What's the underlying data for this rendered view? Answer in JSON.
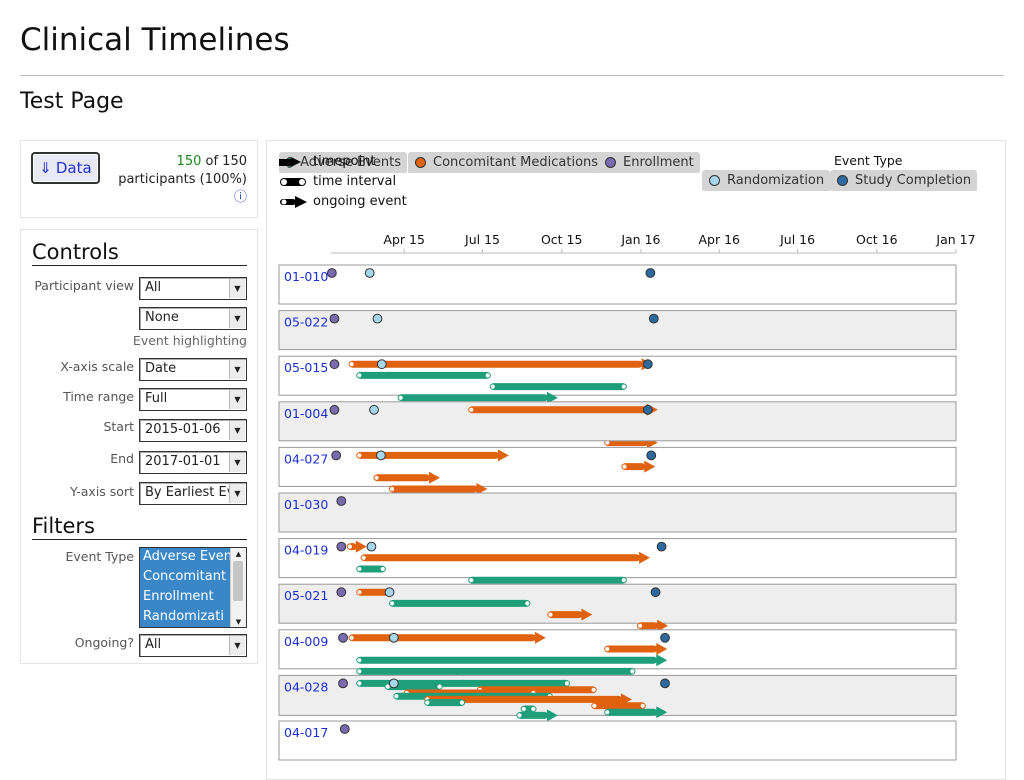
{
  "page": {
    "title": "Clinical Timelines",
    "subtitle": "Test Page"
  },
  "data_panel": {
    "button_label": "Data",
    "button_icon": "arrow-down-icon",
    "count": "150",
    "count_suffix": "of 150",
    "count_line2": "participants (100%)",
    "info_icon": "info-icon"
  },
  "controls": {
    "heading": "Controls",
    "participant_view_label": "Participant view",
    "participant_view_value": "All",
    "highlight_value": "None",
    "highlight_label": "Event highlighting",
    "xaxis_label": "X-axis scale",
    "xaxis_value": "Date",
    "range_label": "Time range",
    "range_value": "Full",
    "start_label": "Start",
    "start_value": "2015-01-06",
    "end_label": "End",
    "end_value": "2017-01-01",
    "sort_label": "Y-axis sort",
    "sort_value": "By Earliest Ev"
  },
  "filters": {
    "heading": "Filters",
    "event_type_label": "Event Type",
    "event_type_options": [
      "Adverse Even",
      "Concomitant",
      "Enrollment",
      "Randomizati"
    ],
    "ongoing_label": "Ongoing?",
    "ongoing_value": "All"
  },
  "legend": {
    "shape_items": [
      "timepoint",
      "time interval",
      "ongoing event"
    ],
    "shape_items_overlap": "Adverse Events",
    "title": "Event Type",
    "event_types": [
      {
        "label": "Concomitant Medications",
        "color": "#e0620f"
      },
      {
        "label": "Enrollment",
        "color": "#7a6ab0"
      },
      {
        "label": "Randomization",
        "color": "#a6d6ea"
      },
      {
        "label": "Study Completion",
        "color": "#2c6aa0"
      }
    ]
  },
  "colors": {
    "adverse_events": "#1f9e7a",
    "concomitant_medications": "#e0620f",
    "enrollment": "#7a6ab0",
    "randomization": "#a6d6ea",
    "study_completion": "#2c6aa0",
    "participant_link": "#1b2fd6"
  },
  "chart_data": {
    "type": "timeline",
    "x_axis": {
      "scale": "date",
      "domain": [
        "2015-01-06",
        "2017-01-01"
      ],
      "ticks": [
        "Apr 15",
        "Jul 15",
        "Oct 15",
        "Jan 16",
        "Apr 16",
        "Jul 16",
        "Oct 16",
        "Jan 17"
      ]
    },
    "participants": [
      {
        "id": "01-010",
        "points": [
          {
            "type": "enrollment",
            "date": "2015-01-07"
          },
          {
            "type": "randomization",
            "date": "2015-02-20"
          },
          {
            "type": "completion",
            "date": "2016-01-12"
          }
        ],
        "intervals": []
      },
      {
        "id": "05-022",
        "points": [
          {
            "type": "enrollment",
            "date": "2015-01-10"
          },
          {
            "type": "randomization",
            "date": "2015-03-01"
          },
          {
            "type": "completion",
            "date": "2016-01-16"
          }
        ],
        "intervals": []
      },
      {
        "id": "05-015",
        "points": [
          {
            "type": "enrollment",
            "date": "2015-01-10"
          },
          {
            "type": "randomization",
            "date": "2015-03-06"
          },
          {
            "type": "completion",
            "date": "2016-01-09"
          }
        ],
        "intervals": [
          {
            "type": "cm",
            "start": "2015-01-27",
            "end": "2016-01-03",
            "ongoing": true
          },
          {
            "type": "ae",
            "start": "2015-02-05",
            "end": "2015-07-10"
          },
          {
            "type": "ae",
            "start": "2015-07-10",
            "end": "2015-12-15"
          },
          {
            "type": "ae",
            "start": "2015-03-25",
            "end": "2015-09-15",
            "ongoing": true
          },
          {
            "type": "cm",
            "start": "2015-11-10",
            "end": "2015-12-25"
          },
          {
            "type": "cm",
            "start": "2015-04-15",
            "end": "2015-05-25",
            "ongoing": true
          },
          {
            "type": "ae",
            "start": "2015-08-30",
            "end": "2015-09-25"
          },
          {
            "type": "cm",
            "start": "2015-11-20",
            "end": "2016-01-09",
            "ongoing": true
          }
        ]
      },
      {
        "id": "01-004",
        "points": [
          {
            "type": "enrollment",
            "date": "2015-01-10"
          },
          {
            "type": "randomization",
            "date": "2015-02-25"
          },
          {
            "type": "completion",
            "date": "2016-01-09"
          }
        ],
        "intervals": [
          {
            "type": "cm",
            "start": "2015-06-15",
            "end": "2016-01-09",
            "ongoing": true
          }
        ]
      },
      {
        "id": "04-027",
        "points": [
          {
            "type": "enrollment",
            "date": "2015-01-12"
          },
          {
            "type": "randomization",
            "date": "2015-03-05"
          },
          {
            "type": "completion",
            "date": "2016-01-13"
          }
        ],
        "intervals": [
          {
            "type": "cm",
            "start": "2015-02-05",
            "end": "2015-07-20",
            "ongoing": true
          },
          {
            "type": "cm",
            "start": "2015-12-10",
            "end": "2016-01-06",
            "ongoing": true
          },
          {
            "type": "cm",
            "start": "2015-02-25",
            "end": "2015-05-01",
            "ongoing": true
          },
          {
            "type": "cm",
            "start": "2015-03-15",
            "end": "2015-06-25",
            "ongoing": true
          }
        ]
      },
      {
        "id": "01-030",
        "points": [
          {
            "type": "enrollment",
            "date": "2015-01-18"
          }
        ],
        "intervals": []
      },
      {
        "id": "04-019",
        "points": [
          {
            "type": "enrollment",
            "date": "2015-01-18"
          },
          {
            "type": "randomization",
            "date": "2015-02-22"
          },
          {
            "type": "completion",
            "date": "2016-01-25"
          }
        ],
        "intervals": [
          {
            "type": "cm",
            "start": "2015-01-25",
            "end": "2015-02-05",
            "ongoing": true
          },
          {
            "type": "cm",
            "start": "2015-02-10",
            "end": "2015-12-31",
            "ongoing": true
          },
          {
            "type": "ae",
            "start": "2015-02-05",
            "end": "2015-03-10"
          },
          {
            "type": "ae",
            "start": "2015-06-15",
            "end": "2015-12-15"
          },
          {
            "type": "ae",
            "start": "2015-03-05",
            "end": "2015-05-15"
          },
          {
            "type": "ae",
            "start": "2015-03-10",
            "end": "2015-12-01"
          }
        ]
      },
      {
        "id": "05-021",
        "points": [
          {
            "type": "enrollment",
            "date": "2015-01-18"
          },
          {
            "type": "randomization",
            "date": "2015-03-15"
          },
          {
            "type": "completion",
            "date": "2016-01-18"
          }
        ],
        "intervals": [
          {
            "type": "cm",
            "start": "2015-02-05",
            "end": "2015-03-15"
          },
          {
            "type": "ae",
            "start": "2015-03-15",
            "end": "2015-08-25"
          },
          {
            "type": "cm",
            "start": "2015-09-15",
            "end": "2015-10-25",
            "ongoing": true
          },
          {
            "type": "cm",
            "start": "2015-12-28",
            "end": "2016-01-21",
            "ongoing": true
          },
          {
            "type": "ae",
            "start": "2015-03-30",
            "end": "2015-12-15"
          },
          {
            "type": "ae",
            "start": "2015-04-25",
            "end": "2016-01-15",
            "ongoing": true
          },
          {
            "type": "cm",
            "start": "2015-07-15",
            "end": "2015-09-10"
          },
          {
            "type": "ae",
            "start": "2015-04-20",
            "end": "2015-06-01",
            "ongoing": true
          }
        ]
      },
      {
        "id": "04-009",
        "points": [
          {
            "type": "enrollment",
            "date": "2015-01-20"
          },
          {
            "type": "randomization",
            "date": "2015-03-20"
          },
          {
            "type": "completion",
            "date": "2016-01-29"
          }
        ],
        "intervals": [
          {
            "type": "cm",
            "start": "2015-01-27",
            "end": "2015-09-01",
            "ongoing": true
          },
          {
            "type": "cm",
            "start": "2015-11-20",
            "end": "2016-01-20",
            "ongoing": true
          },
          {
            "type": "ae",
            "start": "2015-02-05",
            "end": "2016-01-20",
            "ongoing": true
          },
          {
            "type": "ae",
            "start": "2015-02-05",
            "end": "2015-12-25"
          }
        ]
      },
      {
        "id": "04-028",
        "points": [
          {
            "type": "enrollment",
            "date": "2015-01-20"
          },
          {
            "type": "randomization",
            "date": "2015-03-20"
          },
          {
            "type": "completion",
            "date": "2016-01-29"
          }
        ],
        "intervals": [
          {
            "type": "ae",
            "start": "2015-02-05",
            "end": "2015-10-10"
          },
          {
            "type": "ae",
            "start": "2015-03-10",
            "end": "2015-05-15"
          },
          {
            "type": "cm",
            "start": "2015-06-25",
            "end": "2015-11-10"
          },
          {
            "type": "cm",
            "start": "2015-04-01",
            "end": "2015-09-01"
          },
          {
            "type": "ae",
            "start": "2015-03-20",
            "end": "2015-09-20"
          },
          {
            "type": "cm",
            "start": "2015-04-25",
            "end": "2015-12-10",
            "ongoing": true
          },
          {
            "type": "ae",
            "start": "2015-04-25",
            "end": "2015-06-10"
          },
          {
            "type": "cm",
            "start": "2015-11-05",
            "end": "2016-01-06"
          },
          {
            "type": "ae",
            "start": "2015-08-15",
            "end": "2015-09-01"
          },
          {
            "type": "ae",
            "start": "2015-11-20",
            "end": "2016-01-20",
            "ongoing": true
          },
          {
            "type": "ae",
            "start": "2015-08-10",
            "end": "2015-09-15",
            "ongoing": true
          }
        ]
      },
      {
        "id": "04-017",
        "points": [
          {
            "type": "enrollment",
            "date": "2015-01-22"
          }
        ],
        "intervals": []
      }
    ]
  }
}
